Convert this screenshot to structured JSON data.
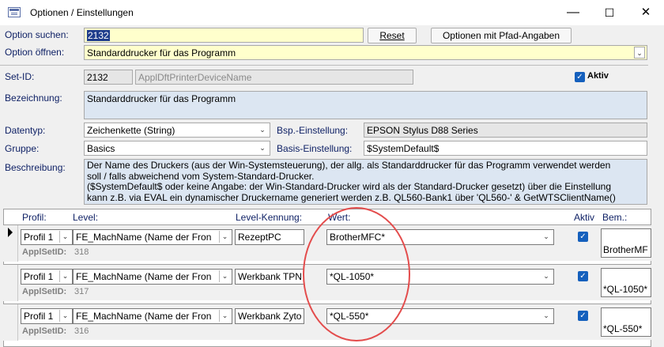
{
  "window": {
    "title": "Optionen / Einstellungen",
    "min": "—",
    "max": "☐",
    "close": "✕"
  },
  "search": {
    "label": "Option suchen:",
    "value": "2132",
    "reset": "Reset",
    "path_button": "Optionen mit Pfad-Angaben"
  },
  "open": {
    "label": "Option öffnen:",
    "value": "Standarddrucker für das Programm"
  },
  "setid": {
    "label": "Set-ID:",
    "value": "2132",
    "name": "ApplDftPrinterDeviceName",
    "aktiv_label": "Aktiv"
  },
  "bezeichnung": {
    "label": "Bezeichnung:",
    "value": "Standarddrucker für das Programm"
  },
  "datentyp": {
    "label": "Datentyp:",
    "value": "Zeichenkette (String)"
  },
  "gruppe": {
    "label": "Gruppe:",
    "value": "Basics"
  },
  "bsp": {
    "label": "Bsp.-Einstellung:",
    "value": "EPSON Stylus D88 Series"
  },
  "basis": {
    "label": "Basis-Einstellung:",
    "value": "$SystemDefault$"
  },
  "beschreibung": {
    "label": "Beschreibung:",
    "lines": [
      "Der Name des Druckers (aus der Win-Systemsteuerung), der allg. als Standarddrucker für das Programm verwendet werden",
      "soll / falls abweichend vom System-Standard-Drucker.",
      "($SystemDefault$ oder keine Angabe: der Win-Standard-Drucker wird als der Standard-Drucker gesetzt) über die Einstellung",
      "kann z.B. via EVAL ein dynamischer Druckername generiert werden z.B. QL560-Bank1 über 'QL560-' & GetWTSClientName()"
    ]
  },
  "grid": {
    "headers": {
      "profil": "Profil:",
      "level": "Level:",
      "kennung": "Level-Kennung:",
      "wert": "Wert:",
      "aktiv": "Aktiv",
      "bem": "Bem.:"
    },
    "applsetid_label": "ApplSetID:",
    "rows": [
      {
        "profil": "Profil 1",
        "level": "FE_MachName   (Name der Fron",
        "kennung": "RezeptPC",
        "wert": "BrotherMFC*",
        "applsetid": "318",
        "bem": "BrotherMF"
      },
      {
        "profil": "Profil 1",
        "level": "FE_MachName   (Name der Fron",
        "kennung": "Werkbank TPN",
        "wert": "*QL-1050*",
        "applsetid": "317",
        "bem": "*QL-1050*"
      },
      {
        "profil": "Profil 1",
        "level": "FE_MachName   (Name der Fron",
        "kennung": "Werkbank Zyto",
        "wert": "*QL-550*",
        "applsetid": "316",
        "bem": "*QL-550*"
      }
    ]
  },
  "colors": {
    "accent": "#1560bd",
    "highlight_ellipse": "#e34c4c",
    "label": "#102266"
  }
}
